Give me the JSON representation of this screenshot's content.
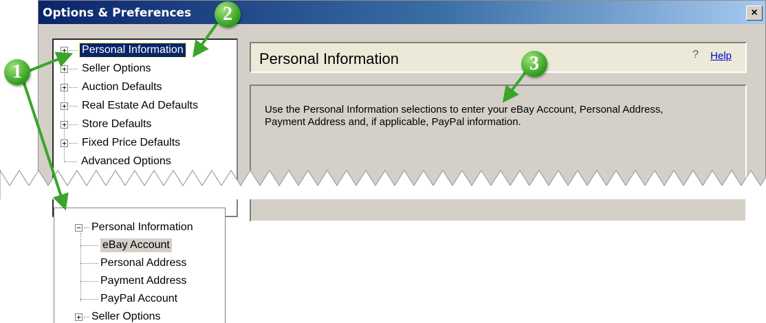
{
  "window": {
    "title": "Options & Preferences",
    "close_label": "×"
  },
  "tree": {
    "items": [
      {
        "label": "Personal Information",
        "toggle": "+"
      },
      {
        "label": "Seller Options",
        "toggle": "+"
      },
      {
        "label": "Auction Defaults",
        "toggle": "+"
      },
      {
        "label": "Real Estate Ad Defaults",
        "toggle": "+"
      },
      {
        "label": "Store Defaults",
        "toggle": "+"
      },
      {
        "label": "Fixed Price Defaults",
        "toggle": "+"
      },
      {
        "label": "Advanced Options",
        "toggle": ""
      }
    ]
  },
  "header": {
    "title": "Personal Information",
    "help_icon": "?",
    "help_label": "Help"
  },
  "content": {
    "description": "Use the Personal Information selections to enter your eBay Account, Personal Address, Payment Address and, if applicable, PayPal information."
  },
  "inset_tree": {
    "parent": {
      "label": "Personal Information",
      "toggle": "−"
    },
    "children": [
      {
        "label": "eBay Account"
      },
      {
        "label": "Personal Address"
      },
      {
        "label": "Payment Address"
      },
      {
        "label": "PayPal Account"
      }
    ],
    "next": {
      "label": "Seller Options",
      "toggle": "+"
    }
  },
  "callouts": [
    "1",
    "2",
    "3"
  ],
  "colors": {
    "titlebar": "#0a246a",
    "selection": "#0a246a",
    "callout_green": "#3aa52a",
    "link": "#0000cc"
  }
}
